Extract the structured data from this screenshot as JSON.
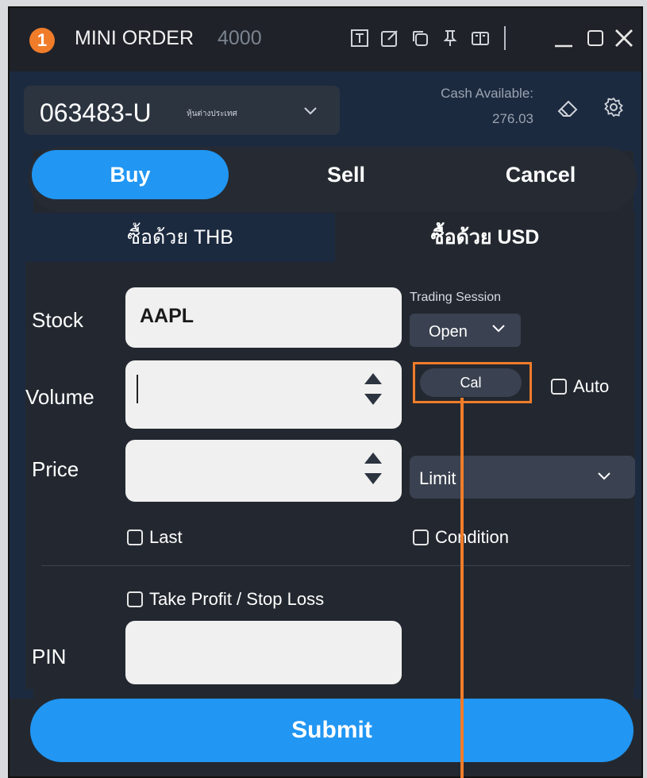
{
  "window": {
    "badge": "1",
    "title": "MINI ORDER",
    "title_number": "4000",
    "toolbar_icons": [
      "text-icon",
      "edit-icon",
      "copy-icon",
      "pin-icon",
      "book-icon"
    ],
    "window_controls": [
      "minimize-icon",
      "maximize-icon",
      "close-icon"
    ]
  },
  "account": {
    "number": "063483-U",
    "type": "หุ้นต่างประเทศ",
    "cash_label": "Cash Available:",
    "cash_value": "276.03"
  },
  "side_tabs": {
    "buy": "Buy",
    "sell": "Sell",
    "cancel": "Cancel",
    "selected": "Buy"
  },
  "currency_tabs": {
    "thb": "ซื้อด้วย THB",
    "usd": "ซื้อด้วย USD",
    "selected": "usd"
  },
  "form": {
    "stock_label": "Stock",
    "stock_value": "AAPL",
    "trading_session_label": "Trading Session",
    "trading_session_value": "Open",
    "volume_label": "Volume",
    "volume_value": "",
    "cal_label": "Cal",
    "auto_label": "Auto",
    "price_label": "Price",
    "price_value": "",
    "order_type": "Limit",
    "last_label": "Last",
    "condition_label": "Condition",
    "tpsl_label": "Take Profit / Stop Loss",
    "pin_label": "PIN",
    "pin_value": ""
  },
  "submit_label": "Submit",
  "colors": {
    "accent_blue": "#2196f3",
    "highlight_orange": "#f07c2a",
    "panel": "#232830",
    "panel_blue": "#1c2a40"
  }
}
